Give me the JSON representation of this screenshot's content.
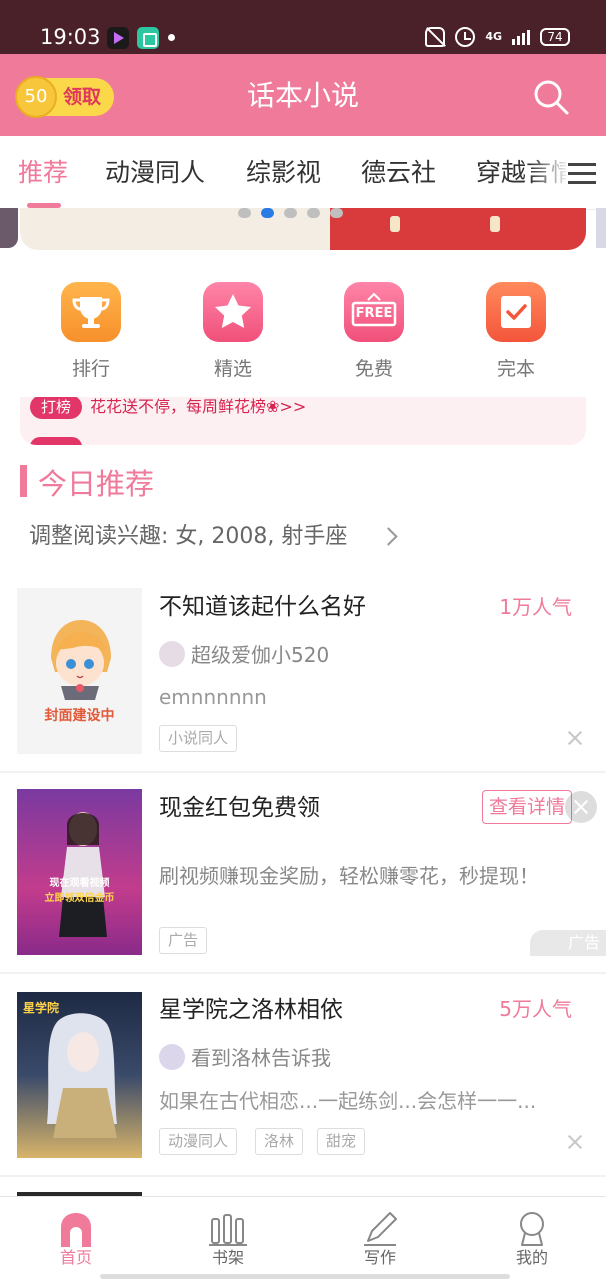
{
  "status_bar": {
    "time": "19:03",
    "network": "4G",
    "battery": "74",
    "icons": [
      "video-app-icon",
      "shop-app-icon",
      "notification-dot",
      "mute-icon",
      "alarm-icon",
      "signal-icon",
      "battery-icon"
    ]
  },
  "header": {
    "coin_value": "50",
    "coin_label": "领取",
    "title": "话本小说",
    "icons": [
      "search-icon"
    ]
  },
  "tabs": [
    "推荐",
    "动漫同人",
    "综影视",
    "德云社",
    "穿越言情"
  ],
  "active_tab": 0,
  "banner": {
    "page_count": 5,
    "active_page": 1
  },
  "quick_entries": [
    {
      "label": "排行",
      "icon": "trophy-icon"
    },
    {
      "label": "精选",
      "icon": "star-icon"
    },
    {
      "label": "免费",
      "icon": "free-icon",
      "icon_text": "FREE"
    },
    {
      "label": "完本",
      "icon": "check-icon"
    }
  ],
  "ticker": {
    "tag": "打榜",
    "text": "花花送不停，每周鲜花榜❀>>"
  },
  "section": {
    "title": "今日推荐",
    "interest": "调整阅读兴趣: 女, 2008, 射手座"
  },
  "books": [
    {
      "title": "不知道该起什么名好",
      "popularity": "1万人气",
      "author": "超级爱伽小520",
      "desc": "emnnnnnn",
      "tags": [
        "小说同人"
      ],
      "cover_text": "封面建设中"
    },
    {
      "title": "星学院之洛林相依",
      "popularity": "5万人气",
      "author": "看到洛林告诉我",
      "desc": "如果在古代相恋...一起练剑...会怎样一一...",
      "tags": [
        "动漫同人",
        "洛林",
        "甜宠"
      ],
      "cover_text": "星学院"
    }
  ],
  "ad": {
    "title": "现金红包免费领",
    "desc": "刷视频赚现金奖励，轻松赚零花，秒提现！",
    "button": "查看详情",
    "tag": "广告",
    "mark": "广告",
    "cover_line1": "现在观看视频",
    "cover_line2": "立即领双倍金币"
  },
  "bottom_nav": [
    {
      "label": "首页",
      "icon": "home-icon"
    },
    {
      "label": "书架",
      "icon": "bookshelf-icon"
    },
    {
      "label": "写作",
      "icon": "pen-icon"
    },
    {
      "label": "我的",
      "icon": "profile-icon"
    }
  ],
  "colors": {
    "accent": "#ef7a9a",
    "status_bar": "#4a2129",
    "coin": "#fbd84a",
    "ticker_text": "#d6244f"
  }
}
